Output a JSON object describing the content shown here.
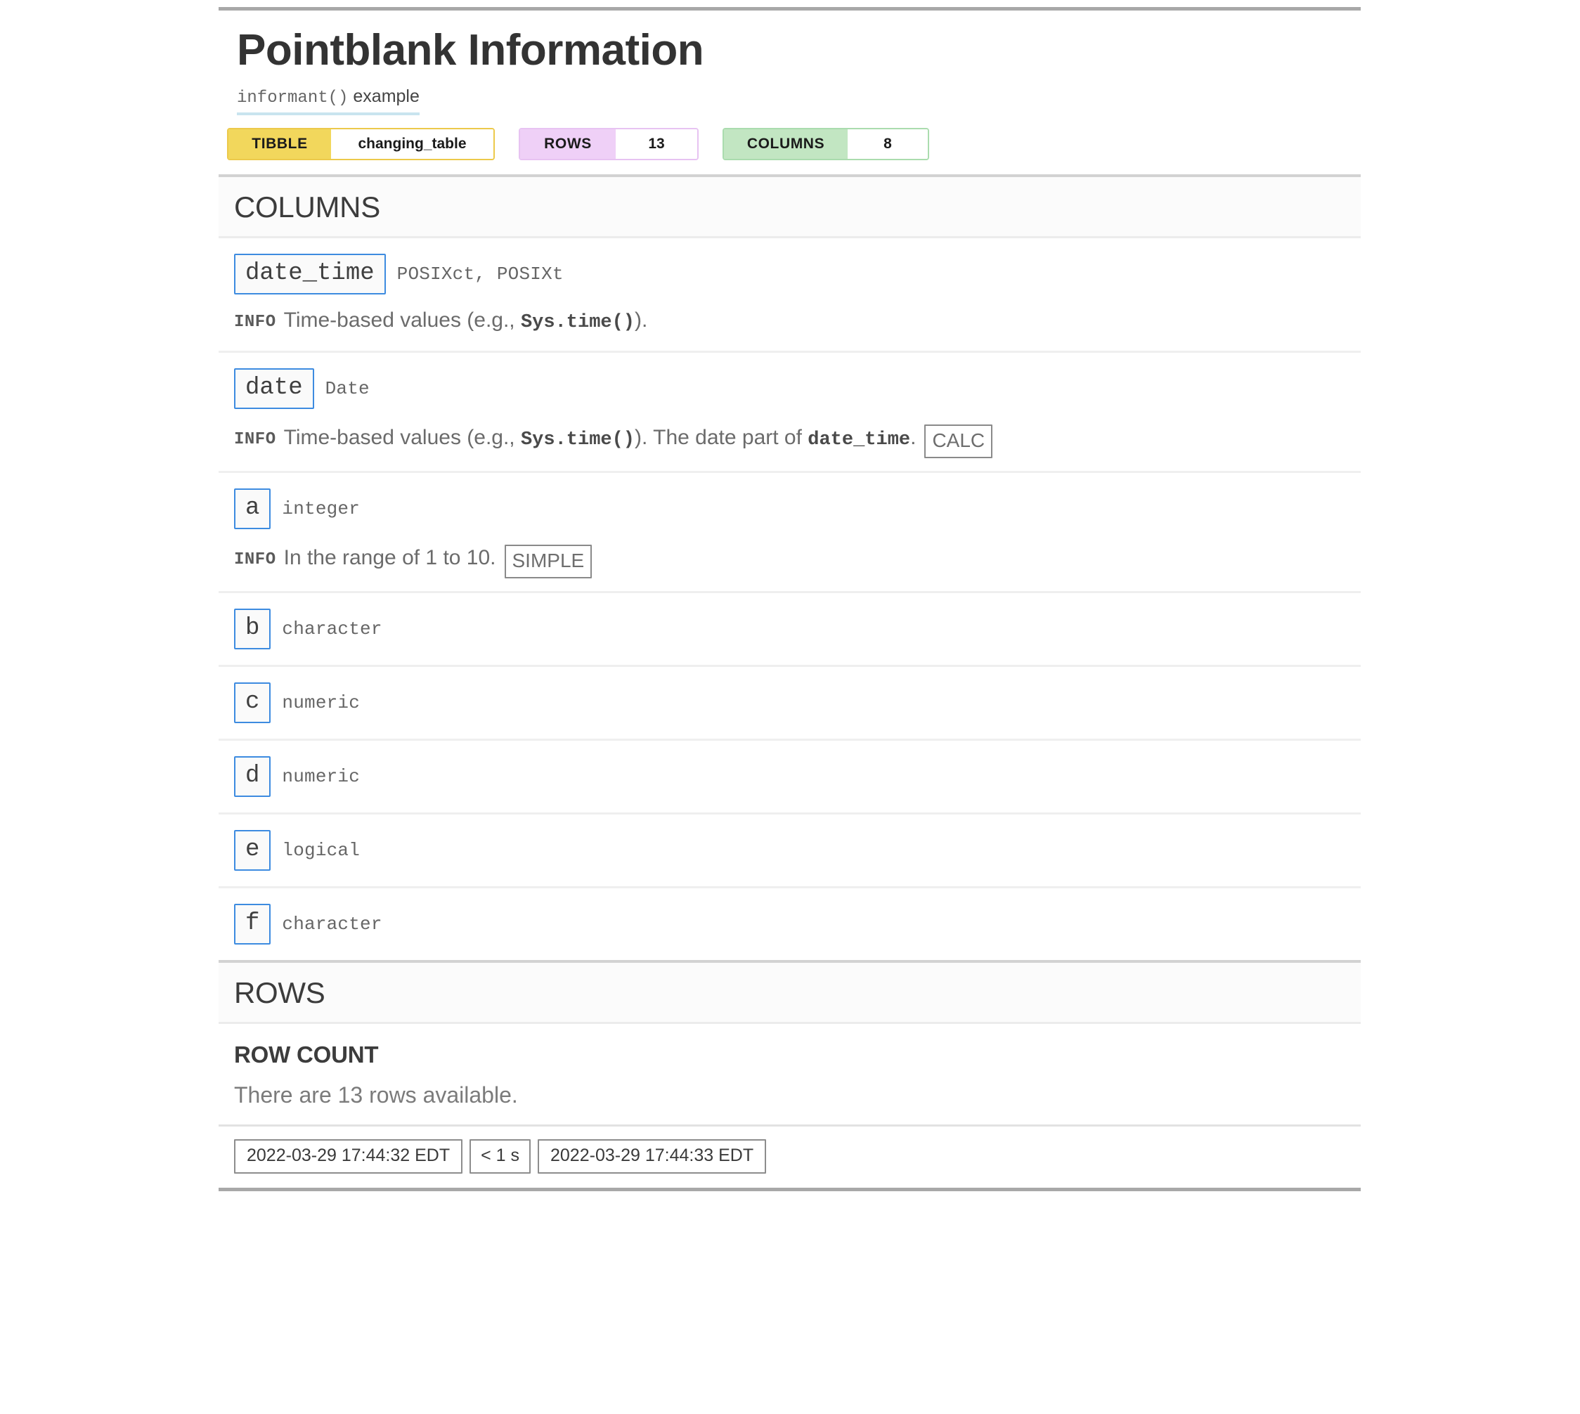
{
  "report": {
    "title": "Pointblank Information",
    "subtitle_code": "informant()",
    "subtitle_rest": " example",
    "badges": [
      {
        "key": "TIBBLE",
        "value": "changing_table",
        "key_color": "#F2D75C",
        "border_color": "#ECC94B"
      },
      {
        "key": "ROWS",
        "value": "13",
        "key_color": "#EFD0F7",
        "border_color": "#E7C3F2"
      },
      {
        "key": "COLUMNS",
        "value": "8",
        "key_color": "#C2E6C2",
        "border_color": "#AADCAE"
      }
    ]
  },
  "columns_section": {
    "heading": "COLUMNS",
    "info_tag": "INFO",
    "items": [
      {
        "name": "date_time",
        "type": "POSIXct, POSIXt",
        "has_info": true,
        "info_parts": [
          {
            "t": "Time-based values (e.g., ",
            "mono": false
          },
          {
            "t": "Sys.time()",
            "mono": true
          },
          {
            "t": ").",
            "mono": false
          }
        ],
        "tag": ""
      },
      {
        "name": "date",
        "type": "Date",
        "has_info": true,
        "info_parts": [
          {
            "t": "Time-based values (e.g., ",
            "mono": false
          },
          {
            "t": "Sys.time()",
            "mono": true
          },
          {
            "t": "). The date part of ",
            "mono": false
          },
          {
            "t": "date_time",
            "mono": true
          },
          {
            "t": ".",
            "mono": false
          }
        ],
        "tag": "CALC"
      },
      {
        "name": "a",
        "type": "integer",
        "has_info": true,
        "info_parts": [
          {
            "t": "In the range of 1 to 10.",
            "mono": false
          }
        ],
        "tag": "SIMPLE"
      },
      {
        "name": "b",
        "type": "character",
        "has_info": false,
        "info_parts": [],
        "tag": ""
      },
      {
        "name": "c",
        "type": "numeric",
        "has_info": false,
        "info_parts": [],
        "tag": ""
      },
      {
        "name": "d",
        "type": "numeric",
        "has_info": false,
        "info_parts": [],
        "tag": ""
      },
      {
        "name": "e",
        "type": "logical",
        "has_info": false,
        "info_parts": [],
        "tag": ""
      },
      {
        "name": "f",
        "type": "character",
        "has_info": false,
        "info_parts": [],
        "tag": ""
      }
    ]
  },
  "rows_section": {
    "heading": "ROWS",
    "row_count_label": "ROW COUNT",
    "row_count_text": "There are 13 rows available."
  },
  "footer": {
    "start_time": "2022-03-29 17:44:32 EDT",
    "duration": "< 1 s",
    "end_time": "2022-03-29 17:44:33 EDT"
  }
}
